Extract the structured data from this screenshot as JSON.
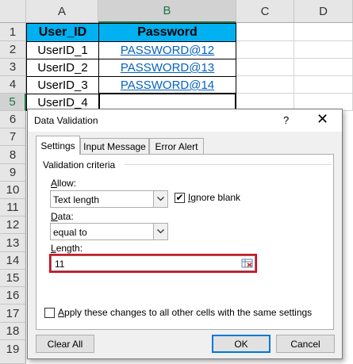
{
  "sheet": {
    "columns": [
      "A",
      "B",
      "C",
      "D"
    ],
    "rows": [
      "1",
      "2",
      "3",
      "4",
      "5",
      "6",
      "7",
      "8",
      "9",
      "10",
      "11",
      "12",
      "13",
      "14",
      "15",
      "16",
      "17",
      "18",
      "19"
    ],
    "table_headers": [
      "User_ID",
      "Password"
    ],
    "table_rows": [
      {
        "user": "UserID_1",
        "password": "PASSWORD@12"
      },
      {
        "user": "UserID_2",
        "password": "PASSWORD@13"
      },
      {
        "user": "UserID_3",
        "password": "PASSWORD@14"
      },
      {
        "user": "UserID_4",
        "password": ""
      }
    ],
    "header_fill": "#00b0f0",
    "link_color": "#0563c1"
  },
  "dialog": {
    "title": "Data Validation",
    "help": "?",
    "close": "✕",
    "tabs": [
      "Settings",
      "Input Message",
      "Error Alert"
    ],
    "active_tab": "Settings",
    "group_label": "Validation criteria",
    "allow": {
      "label_prefix": "",
      "label_key": "A",
      "label_rest": "llow:",
      "value": "Text length"
    },
    "ignore_blank": {
      "key": "I",
      "rest": "gnore blank",
      "checked": true,
      "mark": "✔"
    },
    "data": {
      "label_key": "D",
      "label_rest": "ata:",
      "value": "equal to"
    },
    "length": {
      "label_key": "L",
      "label_rest": "ength:",
      "value": "11"
    },
    "apply_all": {
      "prefix": "Apply these changes to all other cells with the same settings",
      "checked": false
    },
    "buttons": {
      "clear_all": "Clear All",
      "ok": "OK",
      "cancel": "Cancel"
    },
    "highlight_color": "#e3001b"
  }
}
